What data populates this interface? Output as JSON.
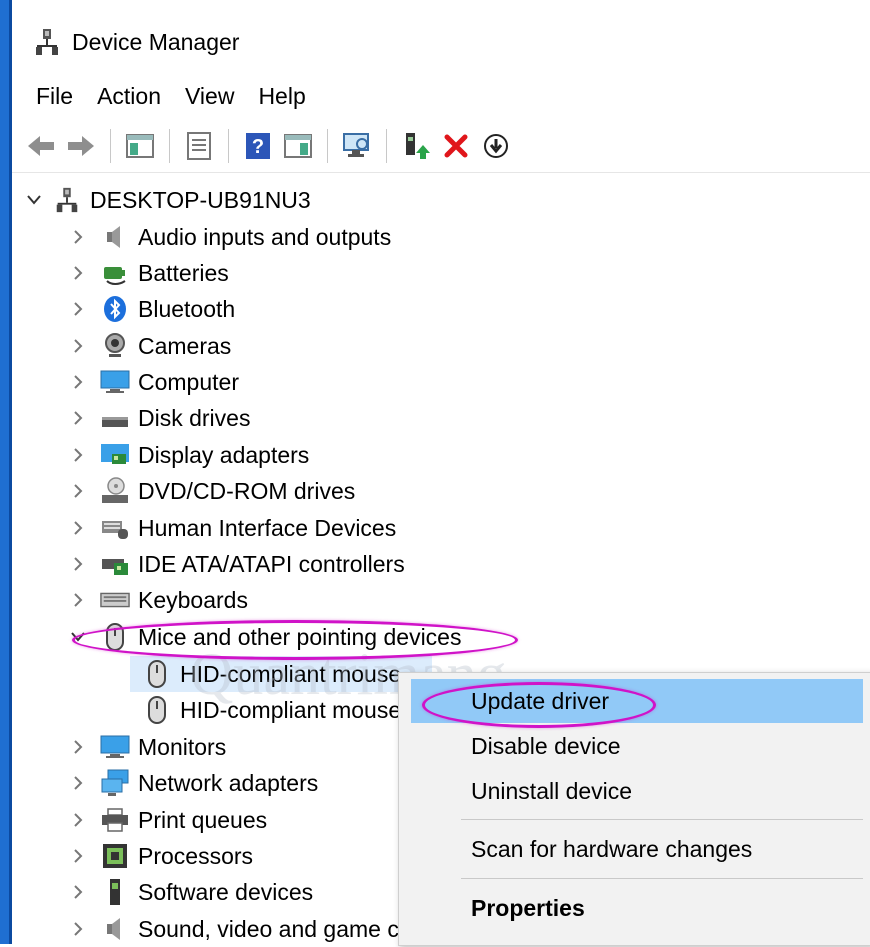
{
  "window": {
    "title": "Device Manager"
  },
  "menu": [
    "File",
    "Action",
    "View",
    "Help"
  ],
  "tree": {
    "root": "DESKTOP-UB91NU3",
    "categories": [
      {
        "label": "Audio inputs and outputs",
        "icon": "speaker-icon"
      },
      {
        "label": "Batteries",
        "icon": "battery-icon"
      },
      {
        "label": "Bluetooth",
        "icon": "bluetooth-icon"
      },
      {
        "label": "Cameras",
        "icon": "camera-icon"
      },
      {
        "label": "Computer",
        "icon": "computer-icon"
      },
      {
        "label": "Disk drives",
        "icon": "disk-drive-icon"
      },
      {
        "label": "Display adapters",
        "icon": "display-adapter-icon"
      },
      {
        "label": "DVD/CD-ROM drives",
        "icon": "dvd-drive-icon"
      },
      {
        "label": "Human Interface Devices",
        "icon": "hid-icon"
      },
      {
        "label": "IDE ATA/ATAPI controllers",
        "icon": "ide-controller-icon"
      },
      {
        "label": "Keyboards",
        "icon": "keyboard-icon"
      },
      {
        "label": "Mice and other pointing devices",
        "icon": "mouse-icon"
      },
      {
        "label": "Monitors",
        "icon": "monitor-icon"
      },
      {
        "label": "Network adapters",
        "icon": "network-adapter-icon"
      },
      {
        "label": "Print queues",
        "icon": "printer-icon"
      },
      {
        "label": "Processors",
        "icon": "processor-icon"
      },
      {
        "label": "Software devices",
        "icon": "software-device-icon"
      },
      {
        "label": "Sound, video and game controllers",
        "icon": "speaker-icon"
      }
    ],
    "mice_children": [
      "HID-compliant mouse",
      "HID-compliant mouse"
    ]
  },
  "context_menu": {
    "items": [
      "Update driver",
      "Disable device",
      "Uninstall device"
    ],
    "scan": "Scan for hardware changes",
    "properties": "Properties"
  },
  "watermark": "Quantrimang",
  "colors": {
    "highlight": "#91c9f7",
    "annotation": "#d013c8",
    "titlebar_accent": "#1f6fd1"
  }
}
